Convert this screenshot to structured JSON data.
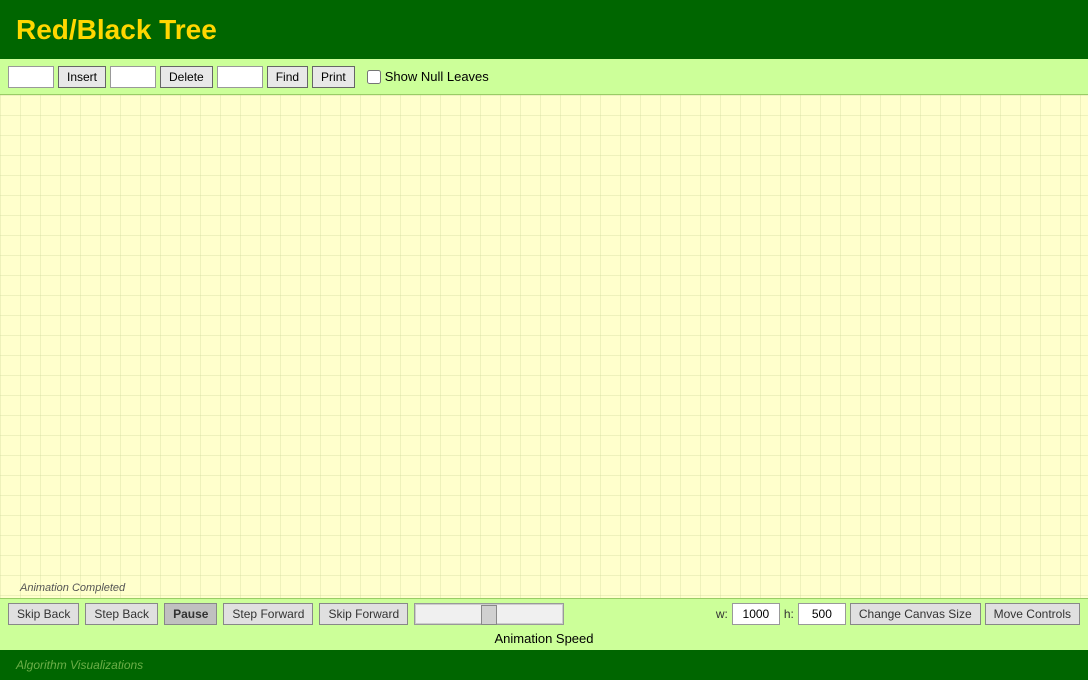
{
  "header": {
    "title": "Red/Black Tree"
  },
  "toolbar": {
    "insert_label": "Insert",
    "delete_label": "Delete",
    "find_label": "Find",
    "print_label": "Print",
    "show_null_leaves_label": "Show Null Leaves",
    "insert_value": "",
    "delete_value": "",
    "find_value": ""
  },
  "canvas": {
    "animation_status": "Animation Completed",
    "background_color": "#FFFFCC"
  },
  "bottom_controls": {
    "skip_back_label": "Skip Back",
    "step_back_label": "Step Back",
    "pause_label": "Pause",
    "step_forward_label": "Step Forward",
    "skip_forward_label": "Skip Forward",
    "width_label": "w:",
    "height_label": "h:",
    "width_value": "1000",
    "height_value": "500",
    "change_canvas_size_label": "Change Canvas Size",
    "move_controls_label": "Move Controls",
    "animation_speed_label": "Animation Speed"
  },
  "footer": {
    "text": "Algorithm Visualizations"
  }
}
